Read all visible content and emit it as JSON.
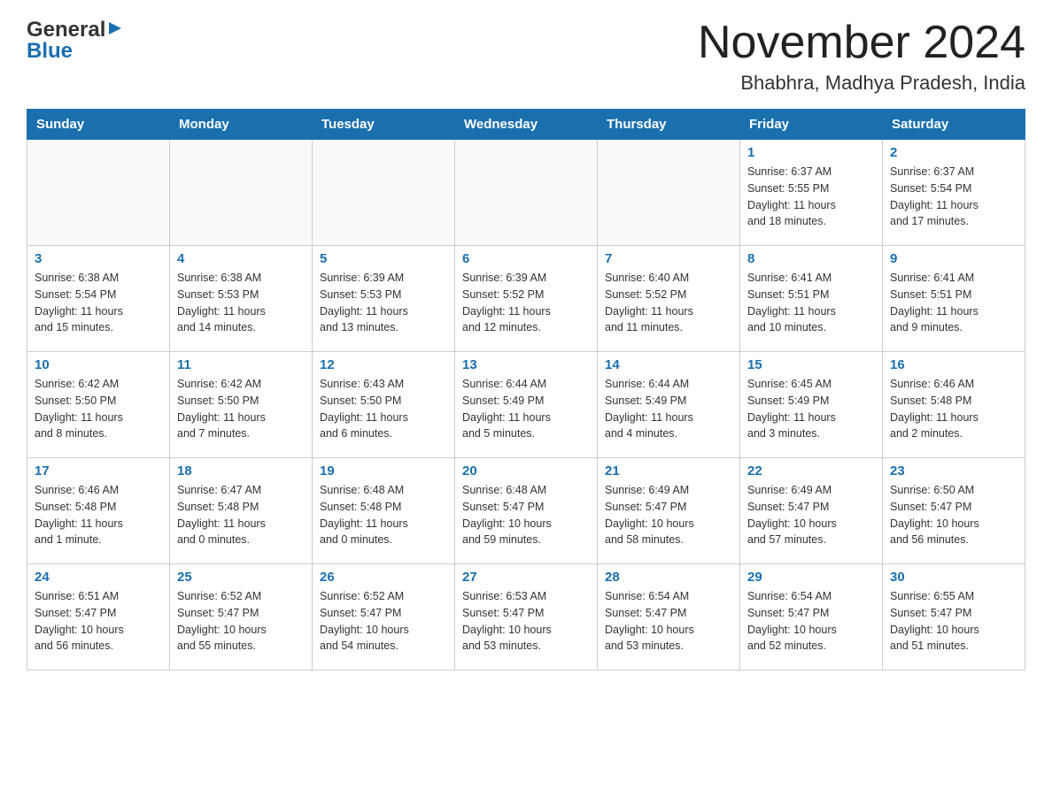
{
  "header": {
    "logo_general": "General",
    "logo_blue": "Blue",
    "month": "November 2024",
    "location": "Bhabhra, Madhya Pradesh, India"
  },
  "days_of_week": [
    "Sunday",
    "Monday",
    "Tuesday",
    "Wednesday",
    "Thursday",
    "Friday",
    "Saturday"
  ],
  "weeks": [
    [
      {
        "day": "",
        "info": ""
      },
      {
        "day": "",
        "info": ""
      },
      {
        "day": "",
        "info": ""
      },
      {
        "day": "",
        "info": ""
      },
      {
        "day": "",
        "info": ""
      },
      {
        "day": "1",
        "info": "Sunrise: 6:37 AM\nSunset: 5:55 PM\nDaylight: 11 hours\nand 18 minutes."
      },
      {
        "day": "2",
        "info": "Sunrise: 6:37 AM\nSunset: 5:54 PM\nDaylight: 11 hours\nand 17 minutes."
      }
    ],
    [
      {
        "day": "3",
        "info": "Sunrise: 6:38 AM\nSunset: 5:54 PM\nDaylight: 11 hours\nand 15 minutes."
      },
      {
        "day": "4",
        "info": "Sunrise: 6:38 AM\nSunset: 5:53 PM\nDaylight: 11 hours\nand 14 minutes."
      },
      {
        "day": "5",
        "info": "Sunrise: 6:39 AM\nSunset: 5:53 PM\nDaylight: 11 hours\nand 13 minutes."
      },
      {
        "day": "6",
        "info": "Sunrise: 6:39 AM\nSunset: 5:52 PM\nDaylight: 11 hours\nand 12 minutes."
      },
      {
        "day": "7",
        "info": "Sunrise: 6:40 AM\nSunset: 5:52 PM\nDaylight: 11 hours\nand 11 minutes."
      },
      {
        "day": "8",
        "info": "Sunrise: 6:41 AM\nSunset: 5:51 PM\nDaylight: 11 hours\nand 10 minutes."
      },
      {
        "day": "9",
        "info": "Sunrise: 6:41 AM\nSunset: 5:51 PM\nDaylight: 11 hours\nand 9 minutes."
      }
    ],
    [
      {
        "day": "10",
        "info": "Sunrise: 6:42 AM\nSunset: 5:50 PM\nDaylight: 11 hours\nand 8 minutes."
      },
      {
        "day": "11",
        "info": "Sunrise: 6:42 AM\nSunset: 5:50 PM\nDaylight: 11 hours\nand 7 minutes."
      },
      {
        "day": "12",
        "info": "Sunrise: 6:43 AM\nSunset: 5:50 PM\nDaylight: 11 hours\nand 6 minutes."
      },
      {
        "day": "13",
        "info": "Sunrise: 6:44 AM\nSunset: 5:49 PM\nDaylight: 11 hours\nand 5 minutes."
      },
      {
        "day": "14",
        "info": "Sunrise: 6:44 AM\nSunset: 5:49 PM\nDaylight: 11 hours\nand 4 minutes."
      },
      {
        "day": "15",
        "info": "Sunrise: 6:45 AM\nSunset: 5:49 PM\nDaylight: 11 hours\nand 3 minutes."
      },
      {
        "day": "16",
        "info": "Sunrise: 6:46 AM\nSunset: 5:48 PM\nDaylight: 11 hours\nand 2 minutes."
      }
    ],
    [
      {
        "day": "17",
        "info": "Sunrise: 6:46 AM\nSunset: 5:48 PM\nDaylight: 11 hours\nand 1 minute."
      },
      {
        "day": "18",
        "info": "Sunrise: 6:47 AM\nSunset: 5:48 PM\nDaylight: 11 hours\nand 0 minutes."
      },
      {
        "day": "19",
        "info": "Sunrise: 6:48 AM\nSunset: 5:48 PM\nDaylight: 11 hours\nand 0 minutes."
      },
      {
        "day": "20",
        "info": "Sunrise: 6:48 AM\nSunset: 5:47 PM\nDaylight: 10 hours\nand 59 minutes."
      },
      {
        "day": "21",
        "info": "Sunrise: 6:49 AM\nSunset: 5:47 PM\nDaylight: 10 hours\nand 58 minutes."
      },
      {
        "day": "22",
        "info": "Sunrise: 6:49 AM\nSunset: 5:47 PM\nDaylight: 10 hours\nand 57 minutes."
      },
      {
        "day": "23",
        "info": "Sunrise: 6:50 AM\nSunset: 5:47 PM\nDaylight: 10 hours\nand 56 minutes."
      }
    ],
    [
      {
        "day": "24",
        "info": "Sunrise: 6:51 AM\nSunset: 5:47 PM\nDaylight: 10 hours\nand 56 minutes."
      },
      {
        "day": "25",
        "info": "Sunrise: 6:52 AM\nSunset: 5:47 PM\nDaylight: 10 hours\nand 55 minutes."
      },
      {
        "day": "26",
        "info": "Sunrise: 6:52 AM\nSunset: 5:47 PM\nDaylight: 10 hours\nand 54 minutes."
      },
      {
        "day": "27",
        "info": "Sunrise: 6:53 AM\nSunset: 5:47 PM\nDaylight: 10 hours\nand 53 minutes."
      },
      {
        "day": "28",
        "info": "Sunrise: 6:54 AM\nSunset: 5:47 PM\nDaylight: 10 hours\nand 53 minutes."
      },
      {
        "day": "29",
        "info": "Sunrise: 6:54 AM\nSunset: 5:47 PM\nDaylight: 10 hours\nand 52 minutes."
      },
      {
        "day": "30",
        "info": "Sunrise: 6:55 AM\nSunset: 5:47 PM\nDaylight: 10 hours\nand 51 minutes."
      }
    ]
  ]
}
